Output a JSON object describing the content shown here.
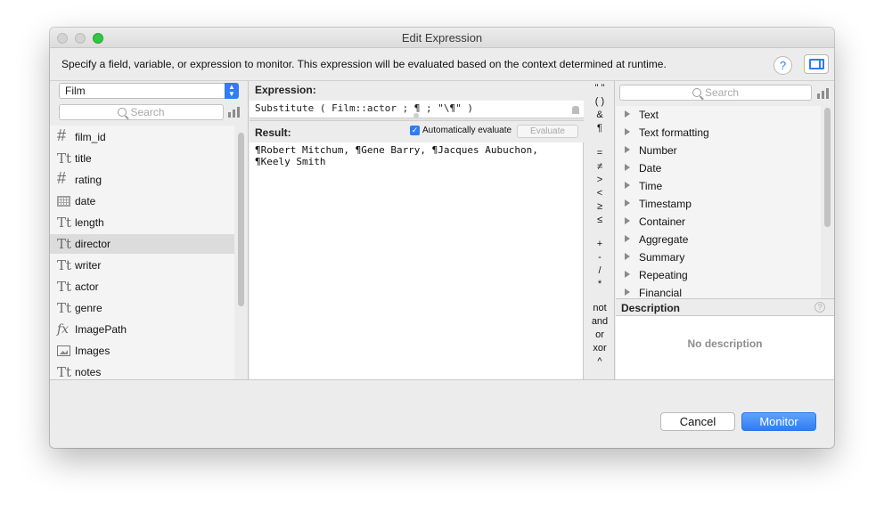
{
  "window": {
    "title": "Edit Expression",
    "instructions": "Specify a field, variable, or expression to monitor. This expression will be evaluated based on the context determined at runtime.",
    "help_glyph": "?"
  },
  "left": {
    "table": "Film",
    "search_placeholder": "Search",
    "fields": [
      {
        "name": "film_id",
        "type": "number",
        "glyph": "#"
      },
      {
        "name": "title",
        "type": "text",
        "glyph": "Tt"
      },
      {
        "name": "rating",
        "type": "number",
        "glyph": "#"
      },
      {
        "name": "date",
        "type": "date",
        "glyph": ""
      },
      {
        "name": "length",
        "type": "text",
        "glyph": "Tt"
      },
      {
        "name": "director",
        "type": "text",
        "glyph": "Tt",
        "selected": true
      },
      {
        "name": "writer",
        "type": "text",
        "glyph": "Tt"
      },
      {
        "name": "actor",
        "type": "text",
        "glyph": "Tt"
      },
      {
        "name": "genre",
        "type": "text",
        "glyph": "Tt"
      },
      {
        "name": "ImagePath",
        "type": "calculation",
        "glyph": "fx"
      },
      {
        "name": "Images",
        "type": "container",
        "glyph": ""
      },
      {
        "name": "notes",
        "type": "text",
        "glyph": "Tt"
      }
    ]
  },
  "middle": {
    "expression_label": "Expression:",
    "expression": "Substitute ( Film::actor ; ¶ ; \"\\¶\" )",
    "result_label": "Result:",
    "auto_evaluate_label": "Automatically evaluate",
    "auto_evaluate_checked": true,
    "evaluate_label": "Evaluate",
    "result_lines": [
      "¶Robert Mitchum, ¶Gene Barry, ¶Jacques Aubuchon,",
      "¶Keely Smith"
    ]
  },
  "operators": [
    "\" \"",
    "( )",
    "&",
    "¶",
    "=",
    "≠",
    ">",
    "<",
    "≥",
    "≤",
    "+",
    "-",
    "/",
    "*",
    "not",
    "and",
    "or",
    "xor",
    "^"
  ],
  "right": {
    "search_placeholder": "Search",
    "functions": [
      "Text",
      "Text formatting",
      "Number",
      "Date",
      "Time",
      "Timestamp",
      "Container",
      "Aggregate",
      "Summary",
      "Repeating",
      "Financial"
    ],
    "description_title": "Description",
    "description_text": "No description"
  },
  "footer": {
    "cancel_label": "Cancel",
    "monitor_label": "Monitor"
  },
  "colors": {
    "accent": "#2f7cf6",
    "zoom_button": "#2fc840"
  }
}
